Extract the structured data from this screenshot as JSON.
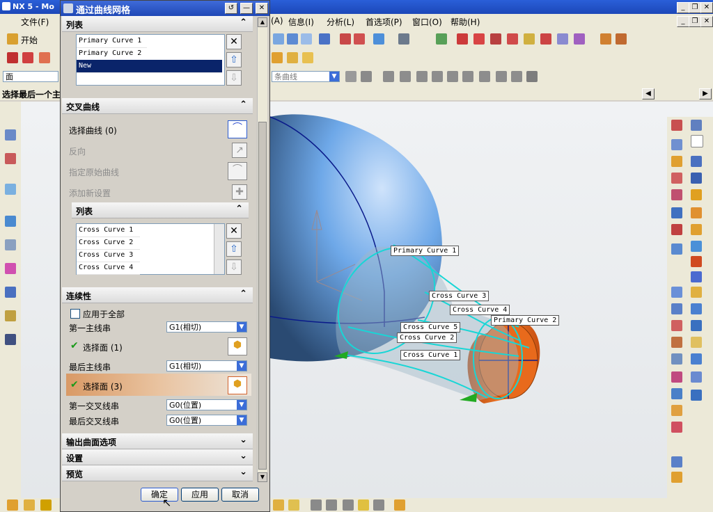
{
  "app": {
    "title": "NX 5 - Mo"
  },
  "menu": {
    "items": [
      "文件(F)",
      "(A)",
      "信息(I)",
      "分析(L)",
      "首选项(P)",
      "窗口(O)",
      "帮助(H)"
    ]
  },
  "toolbar": {
    "start_label": "开始",
    "filter_value": "面",
    "curve_filter": "条曲线"
  },
  "status": {
    "prompt": "选择最后一个主"
  },
  "dialog": {
    "title": "通过曲线网格",
    "primary_list": {
      "header": "列表",
      "rows": [
        "Primary Curve  1",
        "Primary Curve  2",
        "New"
      ]
    },
    "cross_section": {
      "header": "交叉曲线",
      "select_curve": "选择曲线 (0)",
      "reverse": "反向",
      "specify_origin": "指定原始曲线",
      "add_new_set": "添加新设置"
    },
    "cross_list": {
      "header": "列表",
      "rows": [
        "Cross Curve  1",
        "Cross Curve  2",
        "Cross Curve  3",
        "Cross Curve  4"
      ]
    },
    "continuity": {
      "header": "连续性",
      "apply_all": "应用于全部",
      "first_primary_label": "第一主线串",
      "first_primary_value": "G1(相切)",
      "select_face_1": "选择面 (1)",
      "last_primary_label": "最后主线串",
      "last_primary_value": "G1(相切)",
      "select_face_3": "选择面 (3)",
      "first_cross_label": "第一交叉线串",
      "first_cross_value": "G0(位置)",
      "last_cross_label": "最后交叉线串",
      "last_cross_value": "G0(位置)"
    },
    "output_options": "输出曲面选项",
    "settings": "设置",
    "preview": "预览",
    "buttons": {
      "ok": "确定",
      "apply": "应用",
      "cancel": "取消"
    }
  },
  "viewport_labels": {
    "primary1": "Primary Curve  1",
    "primary2": "Primary Curve  2",
    "cross1": "Cross Curve  1",
    "cross2": "Cross Curve  2",
    "cross3": "Cross Curve  3",
    "cross4": "Cross Curve  4",
    "cross5": "Cross Curve  5"
  },
  "colors": {
    "accent": "#1f48b6",
    "selection": "#0a246a",
    "sphere": "#6ea8e8",
    "cylinder": "#e86a1c",
    "curve": "#18d6d6"
  }
}
